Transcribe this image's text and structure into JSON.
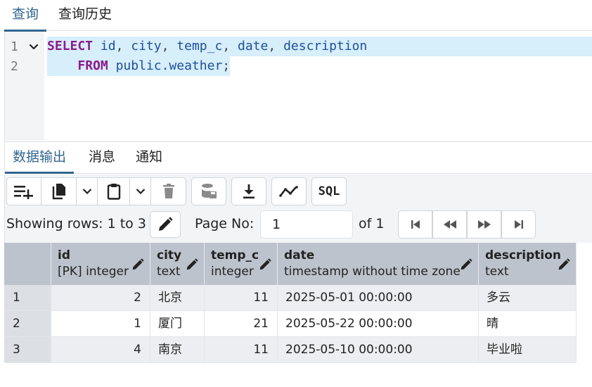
{
  "top_tabs": [
    {
      "label": "查询",
      "active": true
    },
    {
      "label": "查询历史",
      "active": false
    }
  ],
  "editor": {
    "line_numbers": [
      "1",
      "2"
    ],
    "line1": {
      "kw": "SELECT",
      "cols": [
        "id",
        "city",
        "temp_c",
        "date",
        "description"
      ]
    },
    "line2": {
      "kw": "FROM",
      "table": "public.weather"
    }
  },
  "result_tabs": [
    {
      "label": "数据输出",
      "active": true
    },
    {
      "label": "消息",
      "active": false
    },
    {
      "label": "通知",
      "active": false
    }
  ],
  "toolbar": {
    "sql_label": "SQL",
    "showing_rows": "Showing rows: 1 to 3",
    "page_no_label": "Page No:",
    "page_value": "1",
    "of_label": "of 1"
  },
  "grid": {
    "columns": [
      {
        "name": "id",
        "type": "[PK] integer"
      },
      {
        "name": "city",
        "type": "text"
      },
      {
        "name": "temp_c",
        "type": "integer"
      },
      {
        "name": "date",
        "type": "timestamp without time zone"
      },
      {
        "name": "description",
        "type": "text"
      }
    ],
    "rows": [
      {
        "rn": "1",
        "id": "2",
        "city": "北京",
        "temp_c": "11",
        "date": "2025-05-01 00:00:00",
        "description": "多云"
      },
      {
        "rn": "2",
        "id": "1",
        "city": "厦门",
        "temp_c": "21",
        "date": "2025-05-22 00:00:00",
        "description": "晴"
      },
      {
        "rn": "3",
        "id": "4",
        "city": "南京",
        "temp_c": "11",
        "date": "2025-05-10 00:00:00",
        "description": "毕业啦"
      }
    ]
  },
  "colors": {
    "accent": "#326690",
    "keyword": "#8b1a8b",
    "identifier": "#1e4f9a",
    "line_highlight": "#d7eefb",
    "header_bg": "#bdc3cc"
  }
}
